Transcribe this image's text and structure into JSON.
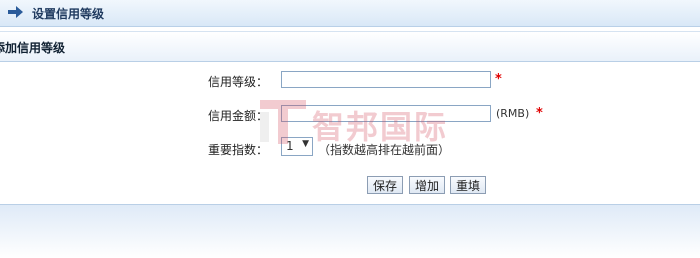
{
  "header": {
    "title": "设置信用等级",
    "icon": "arrow-right-icon",
    "accent": "#2a5b9a"
  },
  "section": {
    "title": "添加信用等级"
  },
  "form": {
    "credit_level": {
      "label": "信用等级：",
      "value": "",
      "required_mark": "*"
    },
    "credit_amount": {
      "label": "信用金额：",
      "value": "",
      "unit": "(RMB)",
      "required_mark": "*"
    },
    "importance": {
      "label": "重要指数：",
      "selected": "1",
      "hint": "（指数越高排在越前面）"
    }
  },
  "buttons": {
    "save": "保存",
    "add": "增加",
    "reset": "重填"
  },
  "watermark": {
    "brand": "智邦国际",
    "logo": "T-logo",
    "color": "#d4475a"
  }
}
